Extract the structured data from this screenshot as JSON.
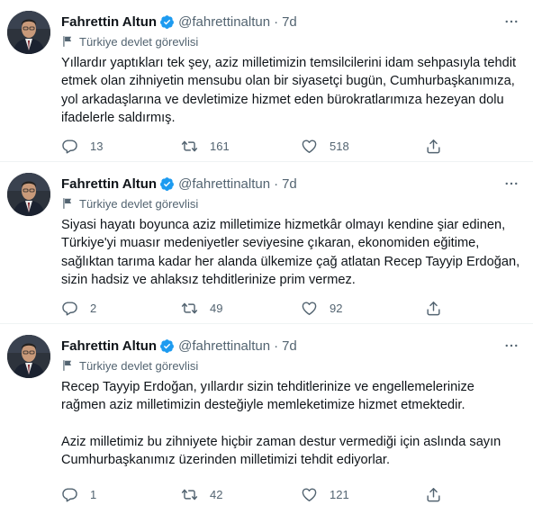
{
  "colors": {
    "verified_badge": "#1d9bf0",
    "text_primary": "#0f1419",
    "text_secondary": "#536471",
    "divider": "#eff3f4"
  },
  "tweets": [
    {
      "author_name": "Fahrettin Altun",
      "handle": "@fahrettinaltun",
      "separator": "·",
      "time": "7d",
      "label": "Türkiye devlet görevlisi",
      "paragraphs": [
        "Yıllardır yaptıkları tek şey, aziz milletimizin temsilcilerini idam sehpasıyla tehdit etmek olan zihniyetin mensubu olan bir siyasetçi bugün, Cumhurbaşkanımıza, yol arkadaşlarına ve devletimize hizmet eden bürokratlarımıza hezeyan dolu ifadelerle saldırmış."
      ],
      "replies": "13",
      "retweets": "161",
      "likes": "518"
    },
    {
      "author_name": "Fahrettin Altun",
      "handle": "@fahrettinaltun",
      "separator": "·",
      "time": "7d",
      "label": "Türkiye devlet görevlisi",
      "paragraphs": [
        "Siyasi hayatı boyunca aziz milletimize hizmetkâr olmayı kendine şiar edinen, Türkiye'yi muasır medeniyetler seviyesine çıkaran, ekonomiden eğitime, sağlıktan tarıma kadar her alanda ülkemize çağ atlatan Recep Tayyip Erdoğan, sizin hadsiz ve ahlaksız tehditlerinize prim vermez."
      ],
      "replies": "2",
      "retweets": "49",
      "likes": "92"
    },
    {
      "author_name": "Fahrettin Altun",
      "handle": "@fahrettinaltun",
      "separator": "·",
      "time": "7d",
      "label": "Türkiye devlet görevlisi",
      "paragraphs": [
        "Recep Tayyip Erdoğan, yıllardır sizin tehditlerinize ve engellemelerinize rağmen aziz milletimizin desteğiyle memleketimize hizmet etmektedir.",
        "Aziz milletimiz bu zihniyete hiçbir zaman destur vermediği için aslında sayın Cumhurbaşkanımız üzerinden milletimizi tehdit ediyorlar."
      ],
      "replies": "1",
      "retweets": "42",
      "likes": "121"
    }
  ],
  "icons": {
    "avatar": "avatar-photo",
    "verified": "verified-badge-icon",
    "label": "flag-icon",
    "more": "more-icon",
    "reply": "reply-icon",
    "retweet": "retweet-icon",
    "like": "heart-icon",
    "share": "share-icon"
  }
}
